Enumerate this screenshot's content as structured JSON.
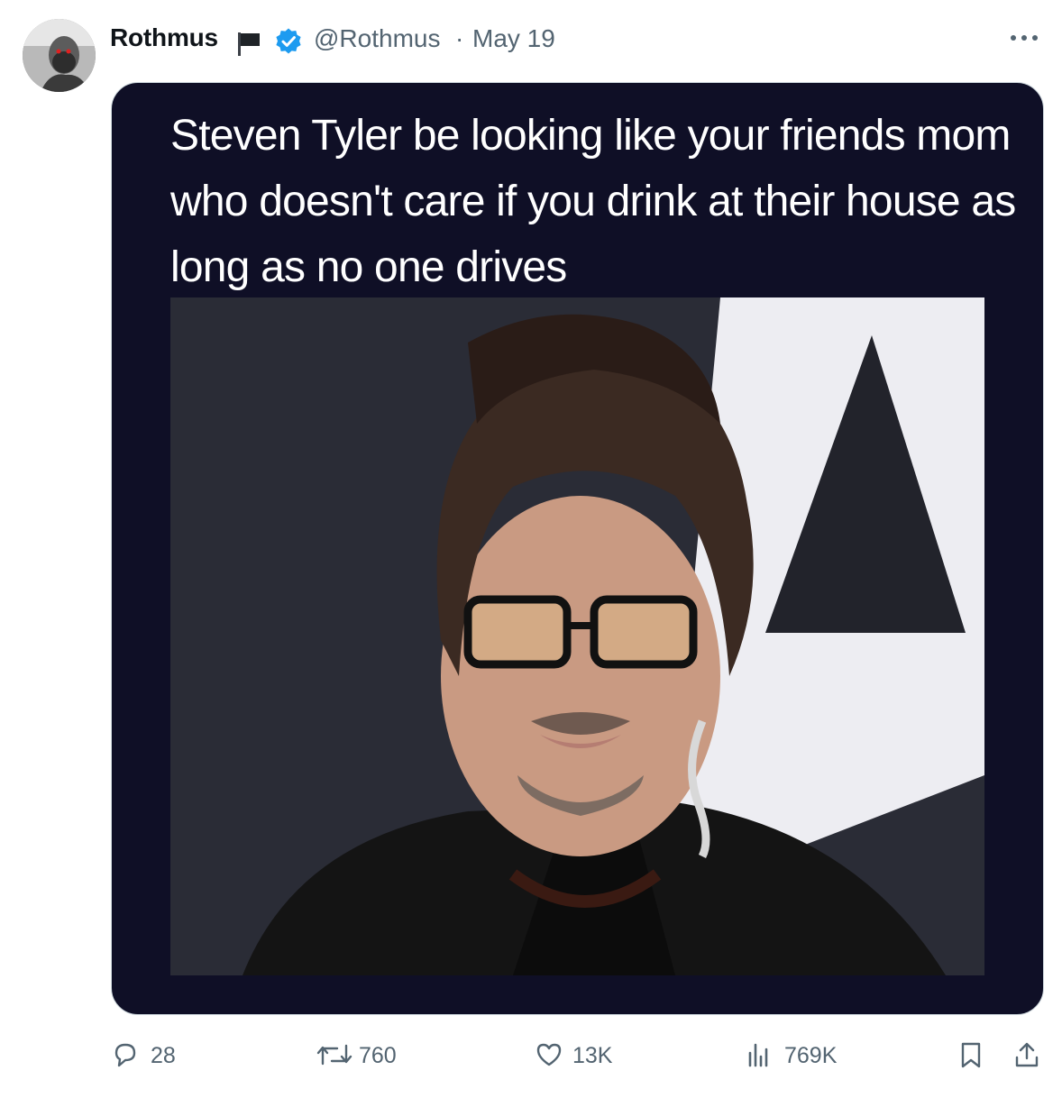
{
  "tweet": {
    "author_name": "Rothmus",
    "handle": "@Rothmus",
    "separator": "·",
    "date": "May 19",
    "meme_text": "Steven Tyler be looking like your friends mom who doesn't care if you drink at their house as long as no one drives"
  },
  "actions": {
    "replies": "28",
    "reposts": "760",
    "likes": "13K",
    "views": "769K"
  },
  "colors": {
    "verified": "#1d9bf0",
    "muted_text": "#536471",
    "media_background": "#0f0f26"
  },
  "icons": [
    "flag-icon",
    "verified-badge-icon",
    "more-icon",
    "reply-icon",
    "repost-icon",
    "like-icon",
    "views-icon",
    "bookmark-icon",
    "share-icon"
  ]
}
